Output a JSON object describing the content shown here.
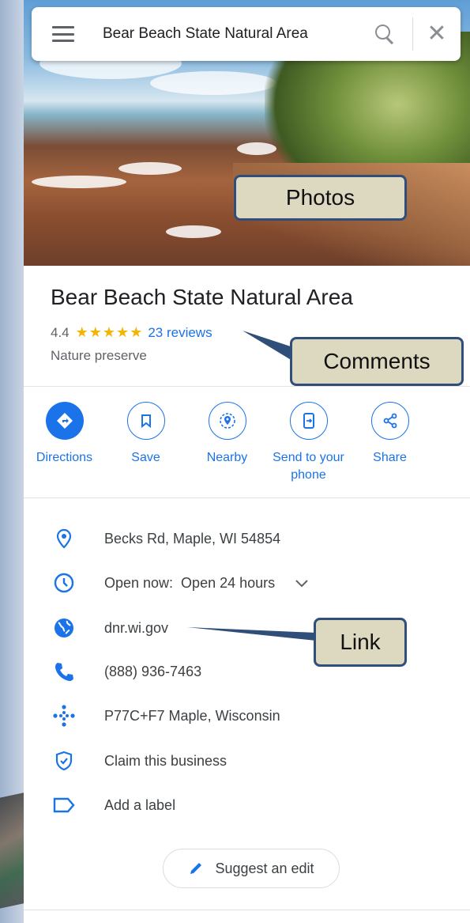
{
  "search": {
    "query": "Bear Beach State Natural Area"
  },
  "photos_callout": "Photos",
  "place": {
    "name": "Bear Beach State Natural Area",
    "rating": "4.4",
    "stars": "★★★★★",
    "reviews": "23 reviews",
    "category": "Nature preserve"
  },
  "comments_callout": "Comments",
  "actions": [
    {
      "label": "Directions",
      "icon": "directions-icon"
    },
    {
      "label": "Save",
      "icon": "bookmark-icon"
    },
    {
      "label": "Nearby",
      "icon": "nearby-icon"
    },
    {
      "label": "Send to your phone",
      "icon": "send-to-phone-icon"
    },
    {
      "label": "Share",
      "icon": "share-icon"
    }
  ],
  "info": {
    "address": "Becks Rd, Maple, WI 54854",
    "hours": "Open now:  Open 24 hours",
    "website": "dnr.wi.gov",
    "phone": "(888) 936-7463",
    "pluscode": "P77C+F7 Maple, Wisconsin",
    "claim": "Claim this business",
    "label": "Add a label"
  },
  "link_callout": "Link",
  "suggest_edit": "Suggest an edit",
  "colors": {
    "accent": "#1a73e8",
    "star": "#f4b400",
    "callout_bg": "#ddd8c0",
    "callout_border": "#2f4f7a"
  }
}
